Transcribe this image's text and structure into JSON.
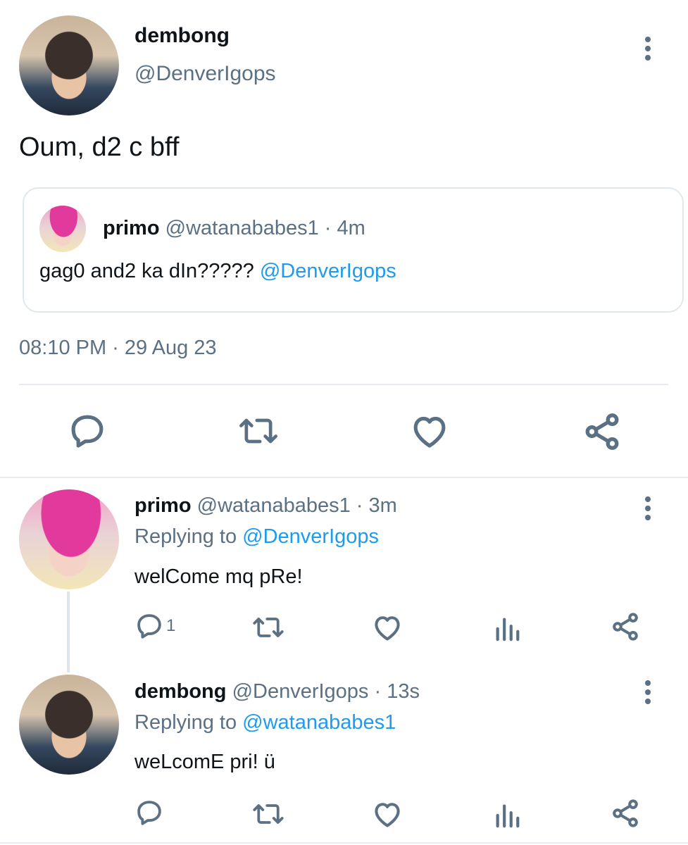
{
  "main_tweet": {
    "display_name": "dembong",
    "handle": "@DenverIgops",
    "text": "Oum, d2 c bff",
    "timestamp": "08:10 PM · 29 Aug 23",
    "quoted": {
      "display_name": "primo",
      "handle": "@watanababes1",
      "time": "· 4m",
      "text": "gag0 and2 ka dIn????? ",
      "mention": "@DenverIgops"
    }
  },
  "replies": [
    {
      "display_name": "primo",
      "handle": "@watanababes1",
      "time": "· 3m",
      "replying_label": "Replying to ",
      "replying_to": "@DenverIgops",
      "text": "welCome mq pRe!",
      "reply_count": "1"
    },
    {
      "display_name": "dembong",
      "handle": "@DenverIgops",
      "time": "· 13s",
      "replying_label": "Replying to ",
      "replying_to": "@watanababes1",
      "text": "weLcomE pri! ü",
      "reply_count": ""
    }
  ],
  "icons": [
    "more-icon",
    "reply-icon",
    "retweet-icon",
    "like-icon",
    "share-icon",
    "analytics-icon"
  ],
  "colors": {
    "accent": "#1d9bf0",
    "muted": "#5b7083",
    "divider": "#e6ecf0"
  }
}
